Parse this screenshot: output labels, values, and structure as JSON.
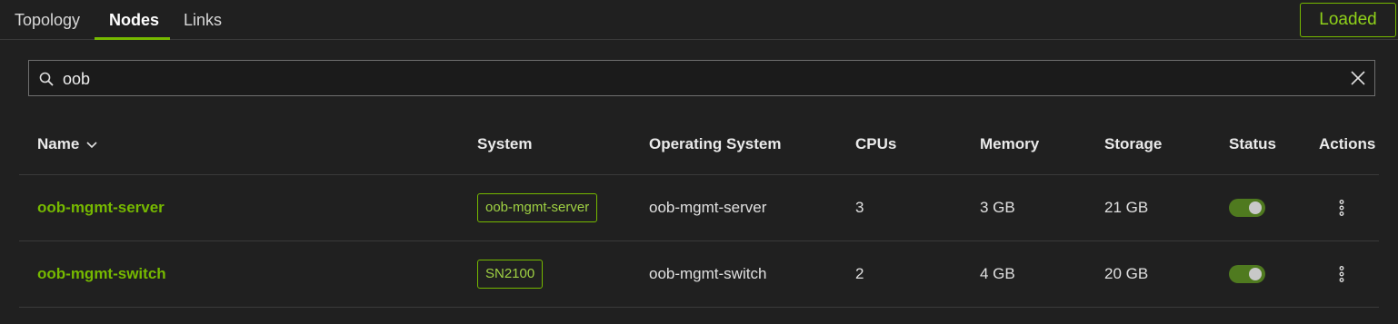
{
  "tabs": [
    {
      "label": "Topology"
    },
    {
      "label": "Nodes"
    },
    {
      "label": "Links"
    }
  ],
  "status_badge": "Loaded",
  "search": {
    "value": "oob"
  },
  "table": {
    "headers": {
      "name": "Name",
      "system": "System",
      "os": "Operating System",
      "cpus": "CPUs",
      "memory": "Memory",
      "storage": "Storage",
      "status": "Status",
      "actions": "Actions"
    },
    "rows": [
      {
        "name": "oob-mgmt-server",
        "system": "oob-mgmt-server",
        "os": "oob-mgmt-server",
        "cpus": "3",
        "memory": "3 GB",
        "storage": "21 GB",
        "status_on": true
      },
      {
        "name": "oob-mgmt-switch",
        "system": "SN2100",
        "os": "oob-mgmt-switch",
        "cpus": "2",
        "memory": "4 GB",
        "storage": "20 GB",
        "status_on": true
      }
    ]
  },
  "colors": {
    "accent": "#76b900",
    "background": "#202020"
  },
  "icons": {
    "search": "search-icon",
    "clear": "close-icon",
    "sort": "chevron-down-icon",
    "actions": "more-vertical-icon"
  }
}
